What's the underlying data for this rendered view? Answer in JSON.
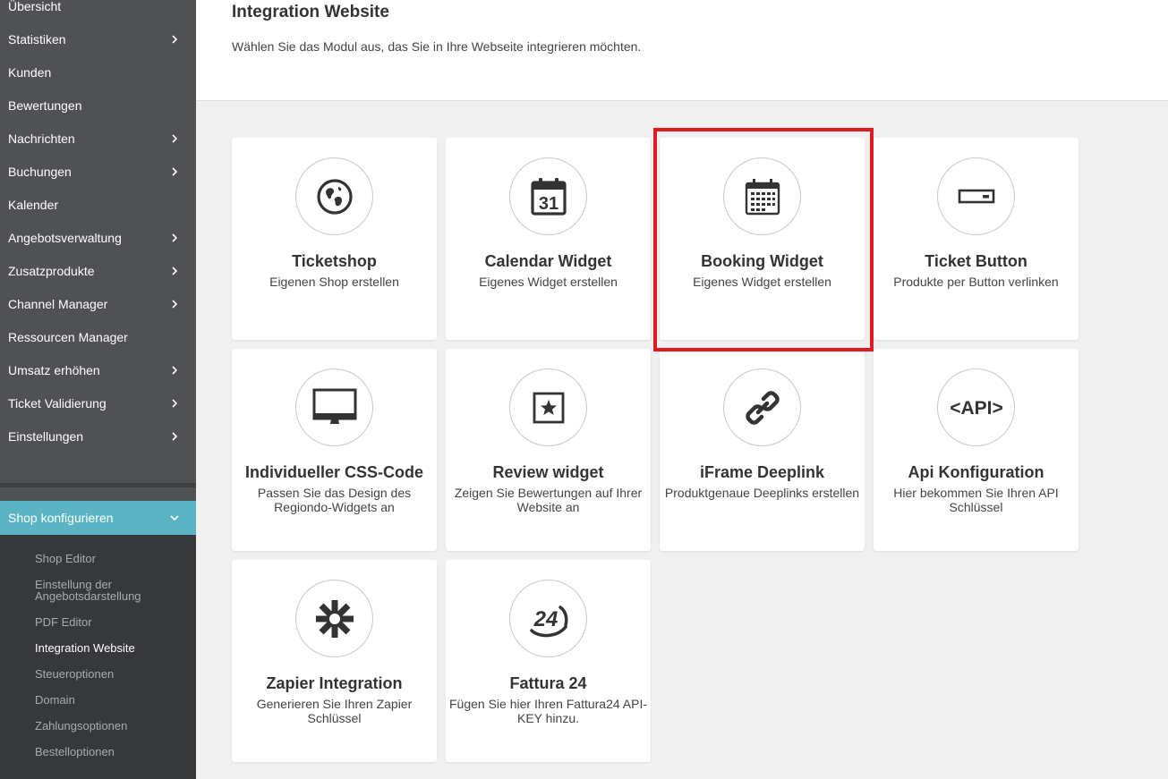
{
  "sidebar": {
    "items": [
      {
        "label": "Übersicht",
        "chevron": false
      },
      {
        "label": "Statistiken",
        "chevron": true
      },
      {
        "label": "Kunden",
        "chevron": false
      },
      {
        "label": "Bewertungen",
        "chevron": false
      },
      {
        "label": "Nachrichten",
        "chevron": true
      },
      {
        "label": "Buchungen",
        "chevron": true
      },
      {
        "label": "Kalender",
        "chevron": false
      },
      {
        "label": "Angebotsverwaltung",
        "chevron": true
      },
      {
        "label": "Zusatzprodukte",
        "chevron": true
      },
      {
        "label": "Channel Manager",
        "chevron": true
      },
      {
        "label": "Ressourcen Manager",
        "chevron": false
      },
      {
        "label": "Umsatz erhöhen",
        "chevron": true
      },
      {
        "label": "Ticket Validierung",
        "chevron": true
      },
      {
        "label": "Einstellungen",
        "chevron": true
      }
    ],
    "active_section": "Shop konfigurieren",
    "submenu": [
      "Shop Editor",
      "Einstellung der Angebotsdarstellung",
      "PDF Editor",
      "Integration Website",
      "Steueroptionen",
      "Domain",
      "Zahlungsoptionen",
      "Bestelloptionen"
    ],
    "current_submenu": "Integration Website",
    "accent_color": "#5ab4c4"
  },
  "header": {
    "title": "Integration Website",
    "subtitle": "Wählen Sie das Modul aus, das Sie in Ihre Webseite integrieren möchten."
  },
  "cards": [
    {
      "title": "Ticketshop",
      "description": "Eigenen Shop erstellen",
      "icon": "globe-icon"
    },
    {
      "title": "Calendar Widget",
      "description": "Eigenes Widget erstellen",
      "icon": "calendar-31-icon",
      "icon_text": "31"
    },
    {
      "title": "Booking Widget",
      "description": "Eigenes Widget erstellen",
      "icon": "calendar-grid-icon"
    },
    {
      "title": "Ticket Button",
      "description": "Produkte per Button verlinken",
      "icon": "button-icon"
    },
    {
      "title": "Individueller CSS-Code",
      "description": "Passen Sie das Design des Regiondo-Widgets an",
      "icon": "monitor-icon"
    },
    {
      "title": "Review widget",
      "description": "Zeigen Sie Bewertungen auf Ihrer Website an",
      "icon": "star-icon"
    },
    {
      "title": "iFrame Deeplink",
      "description": "Produktgenaue Deeplinks erstellen",
      "icon": "link-icon"
    },
    {
      "title": "Api Konfiguration",
      "description": "Hier bekommen Sie Ihren API Schlüssel",
      "icon": "api-icon",
      "icon_text": "<API>"
    },
    {
      "title": "Zapier Integration",
      "description": "Generieren Sie Ihren Zapier Schlüssel",
      "icon": "zapier-icon"
    },
    {
      "title": "Fattura 24",
      "description": "Fügen Sie hier Ihren Fattura24 API-KEY hinzu.",
      "icon": "fattura24-icon",
      "icon_text": "24"
    }
  ],
  "highlighted_card": "Booking Widget",
  "highlight_color": "#e11b22"
}
